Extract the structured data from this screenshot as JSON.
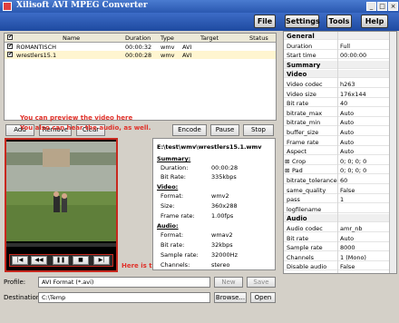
{
  "app": {
    "title": "Xilisoft AVI MPEG Converter"
  },
  "menu": {
    "file": "File",
    "settings": "Settings",
    "tools": "Tools",
    "help": "Help"
  },
  "file_list": {
    "columns": [
      "Name",
      "Duration",
      "Type",
      "Target",
      "Status"
    ],
    "rows": [
      {
        "name": "ROMANTISCH",
        "duration": "00:00:32",
        "type": "wmv",
        "target": "AVI",
        "status": ""
      },
      {
        "name": "wrestlers15.1",
        "duration": "00:00:28",
        "type": "wmv",
        "target": "AVI",
        "status": ""
      }
    ]
  },
  "toolbar": {
    "add": "Add",
    "remove": "Remove",
    "clear": "Clear",
    "encode": "Encode",
    "pause": "Pause",
    "stop": "Stop"
  },
  "annotations": {
    "preview": "You can preview the video here",
    "audio": "You also can hear the audio, as well.",
    "playback": "Here is the Playback area."
  },
  "info": {
    "path": "E:\\test\\wmv\\wrestlers15.1.wmv",
    "summary_title": "Summary:",
    "duration_label": "Duration:",
    "duration_value": "00:00:28",
    "bitrate_label": "Bit Rate:",
    "bitrate_value": "335kbps",
    "video_title": "Video:",
    "v_format_label": "Format:",
    "v_format_value": "wmv2",
    "v_size_label": "Size:",
    "v_size_value": "360x288",
    "v_fps_label": "Frame rate:",
    "v_fps_value": "1.00fps",
    "audio_title": "Audio:",
    "a_format_label": "Format:",
    "a_format_value": "wmav2",
    "a_bitrate_label": "Bit rate:",
    "a_bitrate_value": "32kbps",
    "a_sr_label": "Sample rate:",
    "a_sr_value": "32000Hz",
    "a_ch_label": "Channels:",
    "a_ch_value": "stereo"
  },
  "player": {
    "buttons": [
      "|◀",
      "◀◀",
      "❚❚",
      "■",
      "▶|"
    ]
  },
  "output": {
    "profile_label": "Profile:",
    "profile_value": "AVI Format (*.avi)",
    "new_label": "New",
    "save_label": "Save",
    "destination_label": "Destination:",
    "destination_value": "C:\\Temp",
    "browse_label": "Browse...",
    "open_label": "Open"
  },
  "properties": [
    {
      "kind": "section",
      "label": "General"
    },
    {
      "kind": "row",
      "label": "Duration",
      "value": "Full"
    },
    {
      "kind": "row",
      "label": "Start time",
      "value": "00:00:00"
    },
    {
      "kind": "section",
      "label": "Summary"
    },
    {
      "kind": "section",
      "label": "Video"
    },
    {
      "kind": "row",
      "label": "Video codec",
      "value": "h263"
    },
    {
      "kind": "row",
      "label": "Video size",
      "value": "176x144"
    },
    {
      "kind": "row",
      "label": "Bit rate",
      "value": "40"
    },
    {
      "kind": "row",
      "label": "bitrate_max",
      "value": "Auto"
    },
    {
      "kind": "row",
      "label": "bitrate_min",
      "value": "Auto"
    },
    {
      "kind": "row",
      "label": "buffer_size",
      "value": "Auto"
    },
    {
      "kind": "row",
      "label": "Frame rate",
      "value": "Auto"
    },
    {
      "kind": "row",
      "label": "Aspect",
      "value": "Auto"
    },
    {
      "kind": "row",
      "label": "Crop",
      "value": "0; 0; 0; 0",
      "expand": "⊞"
    },
    {
      "kind": "row",
      "label": "Pad",
      "value": "0; 0; 0; 0",
      "expand": "⊞"
    },
    {
      "kind": "row",
      "label": "bitrate_tolerance",
      "value": "60"
    },
    {
      "kind": "row",
      "label": "same_quality",
      "value": "False"
    },
    {
      "kind": "row",
      "label": "pass",
      "value": "1"
    },
    {
      "kind": "row",
      "label": "logfilename",
      "value": ""
    },
    {
      "kind": "section",
      "label": "Audio"
    },
    {
      "kind": "row",
      "label": "Audio codec",
      "value": "amr_nb"
    },
    {
      "kind": "row",
      "label": "Bit rate",
      "value": "Auto"
    },
    {
      "kind": "row",
      "label": "Sample rate",
      "value": "8000"
    },
    {
      "kind": "row",
      "label": "Channels",
      "value": "1 (Mono)"
    },
    {
      "kind": "row",
      "label": "Disable audio",
      "value": "False"
    }
  ],
  "colors": {
    "titlebar": "#2a58b0",
    "annotation": "#e0312a",
    "selected_row": "#fff5d0"
  }
}
